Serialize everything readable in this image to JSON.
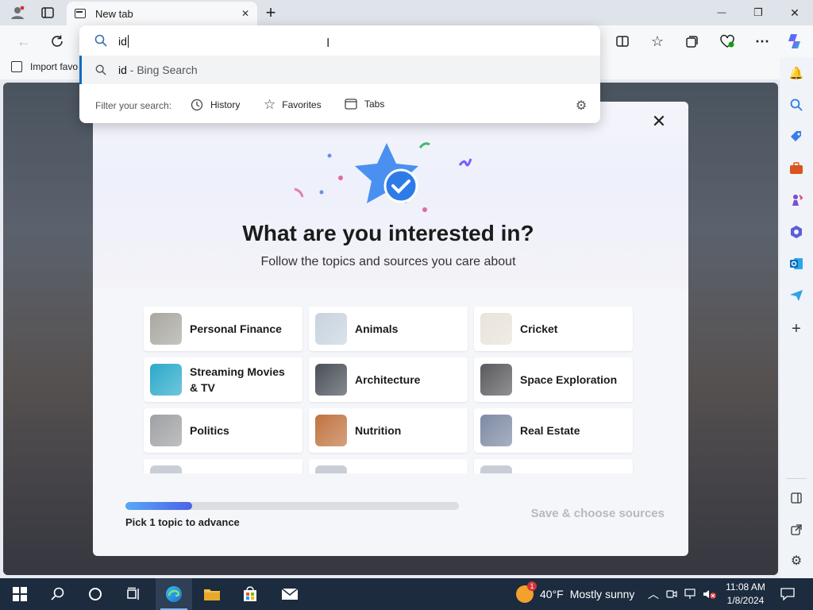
{
  "tab": {
    "title": "New tab",
    "close": "✕",
    "new": "+"
  },
  "window": {
    "minimize": "—",
    "maximize": "❐",
    "close": "✕"
  },
  "address": {
    "value": "id"
  },
  "suggestion": {
    "query": "id",
    "suffix": " - Bing Search"
  },
  "filter": {
    "label": "Filter your search:",
    "items": [
      "History",
      "Favorites",
      "Tabs"
    ]
  },
  "favbar": {
    "import_label": "Import favo"
  },
  "modal": {
    "title": "What are you interested in?",
    "subtitle": "Follow the topics and sources you care about",
    "close": "✕",
    "topics": [
      {
        "label": "Personal Finance",
        "thumb_color": "#a9a7a0"
      },
      {
        "label": "Animals",
        "thumb_color": "#c8d3df"
      },
      {
        "label": "Cricket",
        "thumb_color": "#e8e3da"
      },
      {
        "label": "Streaming Movies & TV",
        "thumb_color": "#2aa9c9"
      },
      {
        "label": "Architecture",
        "thumb_color": "#4a4f58"
      },
      {
        "label": "Space Exploration",
        "thumb_color": "#5a5a5e"
      },
      {
        "label": "Politics",
        "thumb_color": "#9fa0a3"
      },
      {
        "label": "Nutrition",
        "thumb_color": "#c0733f"
      },
      {
        "label": "Real Estate",
        "thumb_color": "#7d8aa3"
      }
    ],
    "progress": {
      "fraction": 0.2,
      "label": "Pick 1 topic to advance"
    },
    "save_label": "Save & choose sources"
  },
  "taskbar": {
    "weather_temp": "40°F",
    "weather_desc": "Mostly sunny",
    "time": "11:08 AM",
    "date": "1/8/2024",
    "weather_badge": "1"
  },
  "colors": {
    "accent": "#0f6cbd",
    "progress": "#4a8cf2",
    "taskbar": "#1c2b3e"
  }
}
